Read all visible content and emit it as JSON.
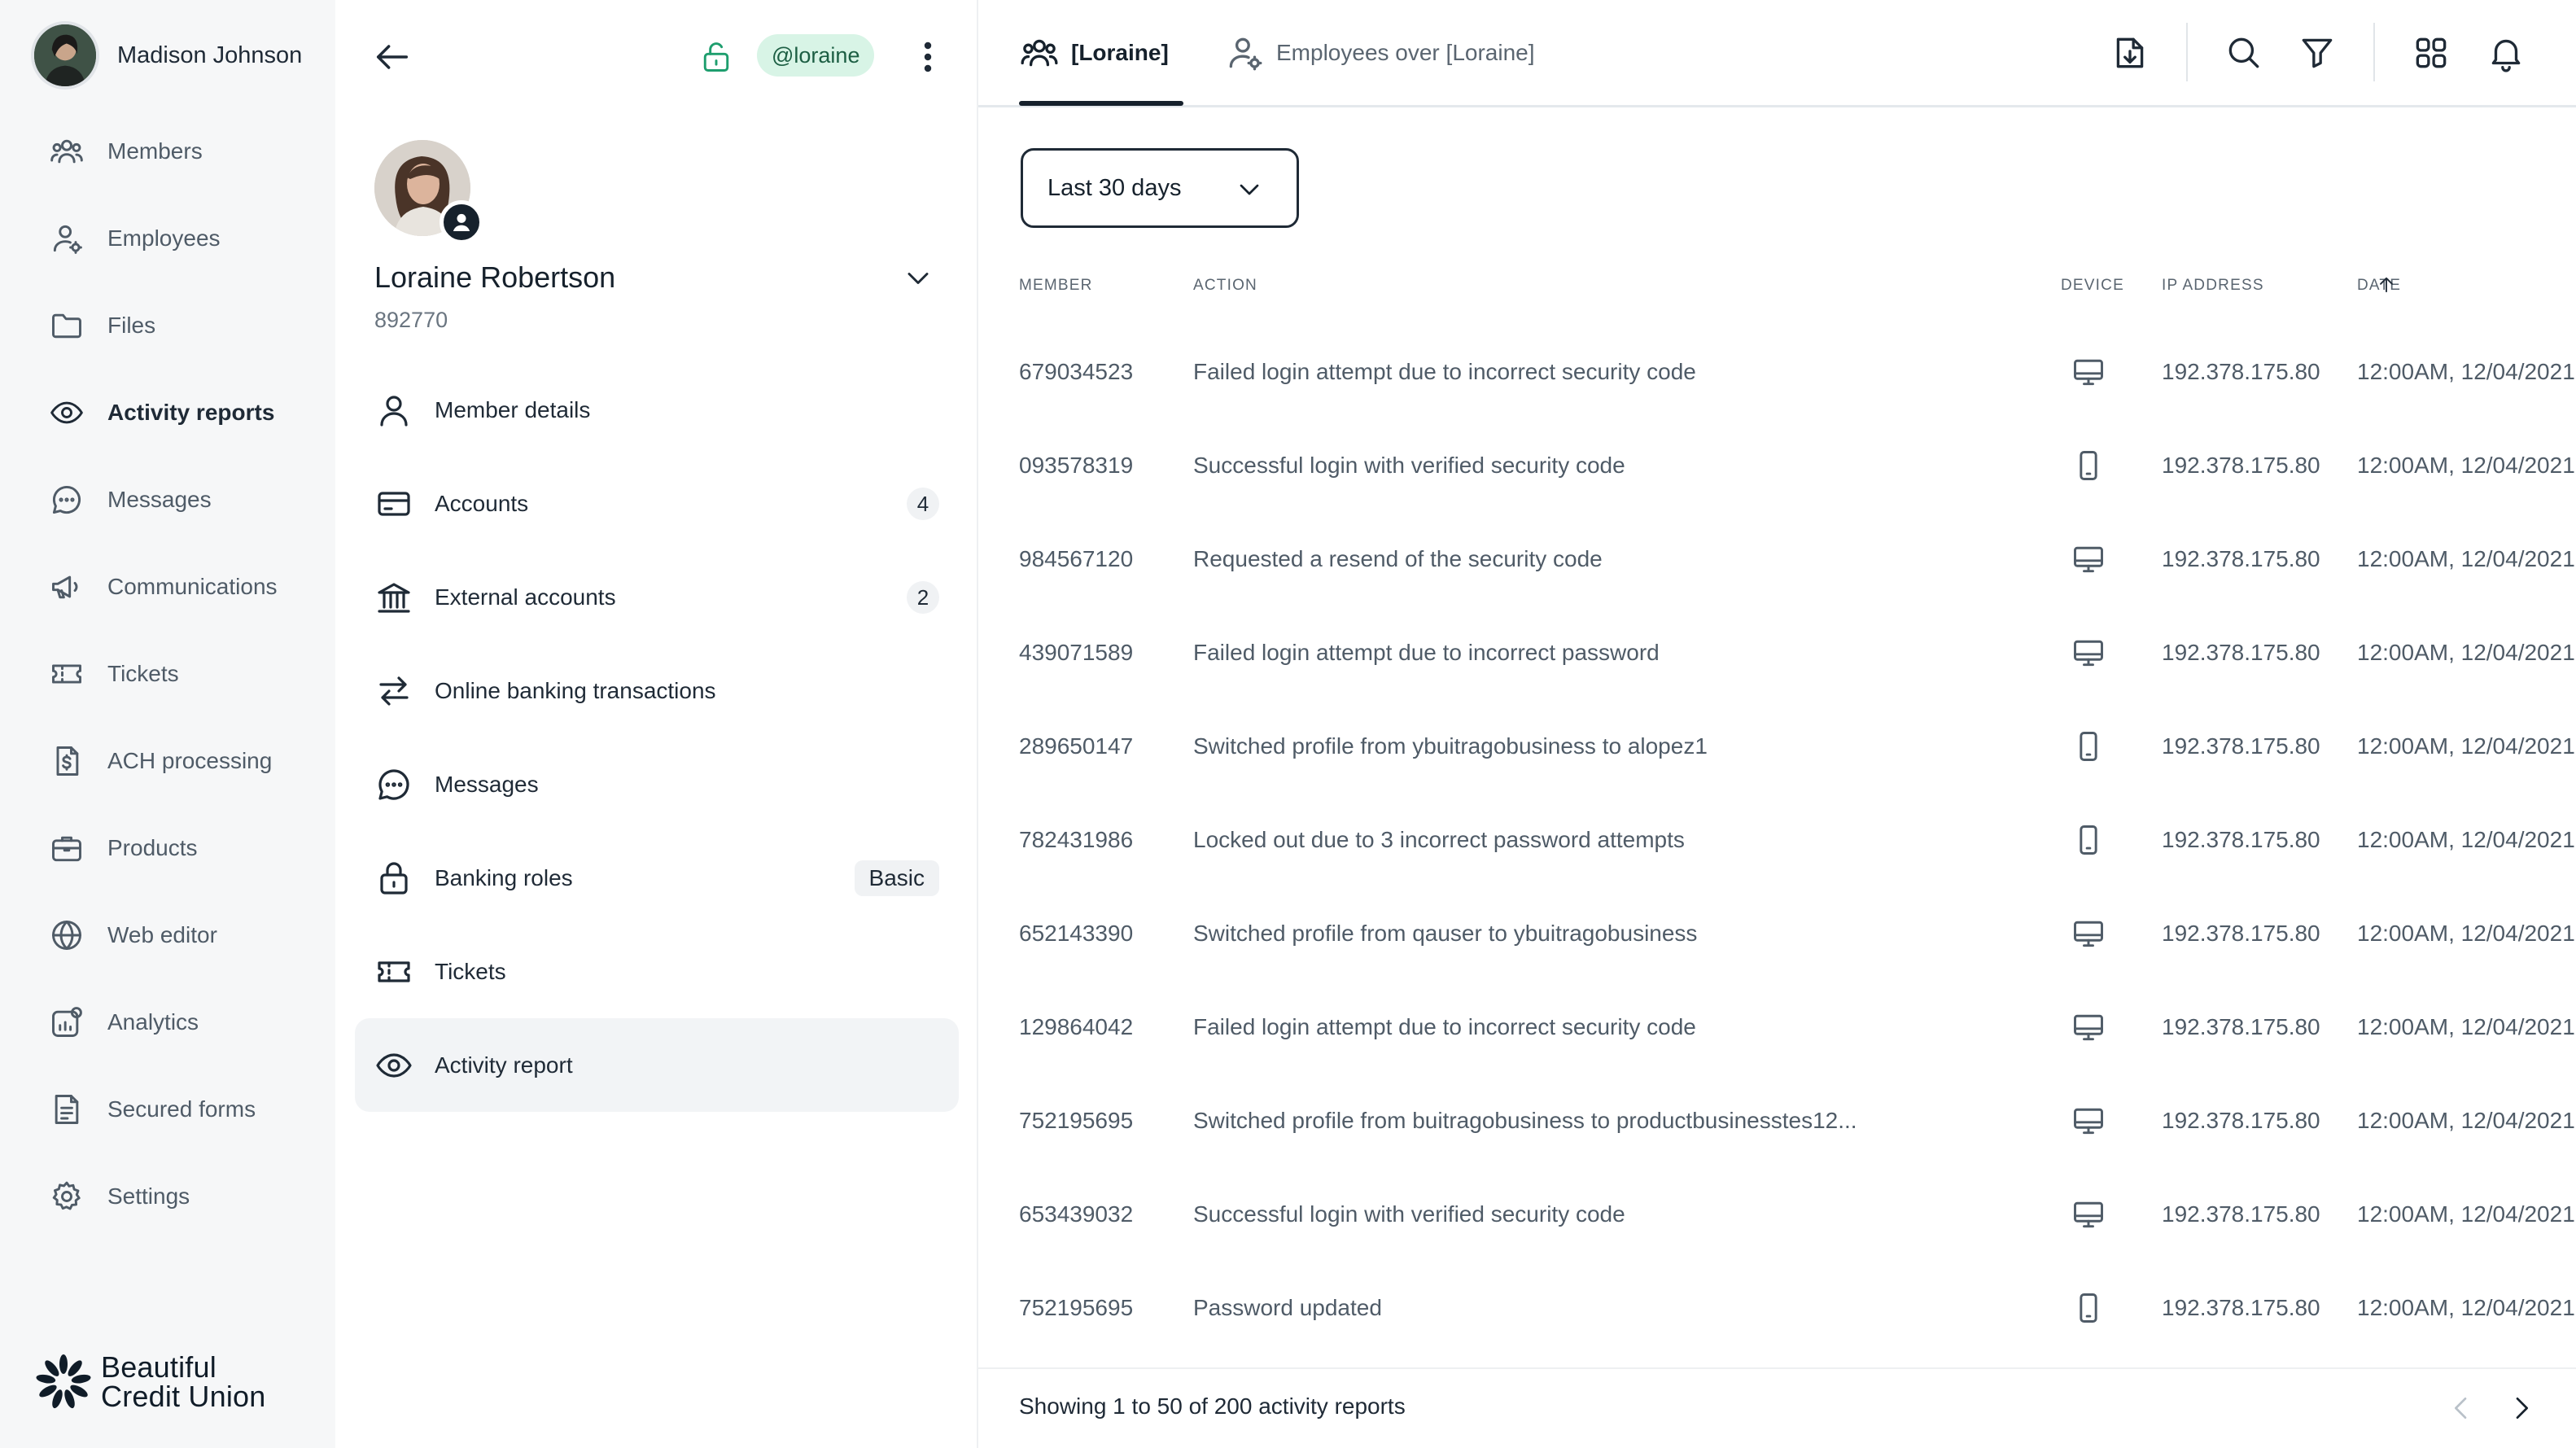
{
  "user": {
    "name": "Madison Johnson"
  },
  "sidebar": {
    "items": [
      {
        "label": "Members",
        "icon": "members-icon"
      },
      {
        "label": "Employees",
        "icon": "employee-icon"
      },
      {
        "label": "Files",
        "icon": "folder-icon"
      },
      {
        "label": "Activity reports",
        "icon": "eye-icon",
        "active": true
      },
      {
        "label": "Messages",
        "icon": "chat-icon"
      },
      {
        "label": "Communications",
        "icon": "megaphone-icon"
      },
      {
        "label": "Tickets",
        "icon": "ticket-icon"
      },
      {
        "label": "ACH processing",
        "icon": "dollar-document-icon"
      },
      {
        "label": "Products",
        "icon": "briefcase-icon"
      },
      {
        "label": "Web editor",
        "icon": "globe-icon"
      },
      {
        "label": "Analytics",
        "icon": "analytics-icon"
      },
      {
        "label": "Secured forms",
        "icon": "form-icon"
      },
      {
        "label": "Settings",
        "icon": "gear-icon"
      }
    ]
  },
  "brand": {
    "line1": "Beautiful",
    "line2": "Credit Union"
  },
  "member": {
    "handle": "@loraine",
    "name": "Loraine Robertson",
    "id": "892770",
    "menu": [
      {
        "label": "Member details",
        "icon": "user-icon"
      },
      {
        "label": "Accounts",
        "icon": "card-icon",
        "count": "4"
      },
      {
        "label": "External accounts",
        "icon": "bank-icon",
        "count": "2"
      },
      {
        "label": "Online banking transactions",
        "icon": "transfer-icon"
      },
      {
        "label": "Messages",
        "icon": "chat-icon"
      },
      {
        "label": "Banking roles",
        "icon": "lock-icon",
        "tag": "Basic"
      },
      {
        "label": "Tickets",
        "icon": "ticket-icon"
      },
      {
        "label": "Activity report",
        "icon": "eye-icon",
        "active": true
      }
    ]
  },
  "tabs": [
    {
      "label": "[Loraine]",
      "active": true
    },
    {
      "label": "Employees over [Loraine]"
    }
  ],
  "filter": {
    "range": "Last 30 days"
  },
  "table": {
    "headers": {
      "member": "MEMBER",
      "action": "ACTION",
      "device": "DEVICE",
      "ip": "IP ADDRESS",
      "date": "DATE"
    },
    "rows": [
      {
        "member": "679034523",
        "action": "Failed login attempt due to incorrect security code",
        "device": "desktop",
        "ip": "192.378.175.80",
        "date": "12:00AM, 12/04/2021"
      },
      {
        "member": "093578319",
        "action": "Successful login with verified security code",
        "device": "mobile",
        "ip": "192.378.175.80",
        "date": "12:00AM, 12/04/2021"
      },
      {
        "member": "984567120",
        "action": "Requested a resend of the security code",
        "device": "desktop",
        "ip": "192.378.175.80",
        "date": "12:00AM, 12/04/2021"
      },
      {
        "member": "439071589",
        "action": "Failed login attempt due to incorrect password",
        "device": "desktop",
        "ip": "192.378.175.80",
        "date": "12:00AM, 12/04/2021"
      },
      {
        "member": "289650147",
        "action": "Switched profile from ybuitragobusiness to alopez1",
        "device": "mobile",
        "ip": "192.378.175.80",
        "date": "12:00AM, 12/04/2021"
      },
      {
        "member": "782431986",
        "action": "Locked out due to 3 incorrect password attempts",
        "device": "mobile",
        "ip": "192.378.175.80",
        "date": "12:00AM, 12/04/2021"
      },
      {
        "member": "652143390",
        "action": "Switched profile from qauser to ybuitragobusiness",
        "device": "desktop",
        "ip": "192.378.175.80",
        "date": "12:00AM, 12/04/2021"
      },
      {
        "member": "129864042",
        "action": "Failed login attempt due to incorrect security code",
        "device": "desktop",
        "ip": "192.378.175.80",
        "date": "12:00AM, 12/04/2021"
      },
      {
        "member": "752195695",
        "action": "Switched profile from buitragobusiness to productbusinesstes12...",
        "device": "desktop",
        "ip": "192.378.175.80",
        "date": "12:00AM, 12/04/2021"
      },
      {
        "member": "653439032",
        "action": "Successful login with verified security code",
        "device": "desktop",
        "ip": "192.378.175.80",
        "date": "12:00AM, 12/04/2021"
      },
      {
        "member": "752195695",
        "action": "Password updated",
        "device": "mobile",
        "ip": "192.378.175.80",
        "date": "12:00AM, 12/04/2021"
      }
    ]
  },
  "footer": {
    "summary": "Showing 1 to 50 of 200 activity reports"
  },
  "colors": {
    "accent_green": "#1e9e6e",
    "badge_green_bg": "#d8f4e6",
    "sidebar_bg": "#f6f7f8",
    "text_dark": "#16212c"
  }
}
